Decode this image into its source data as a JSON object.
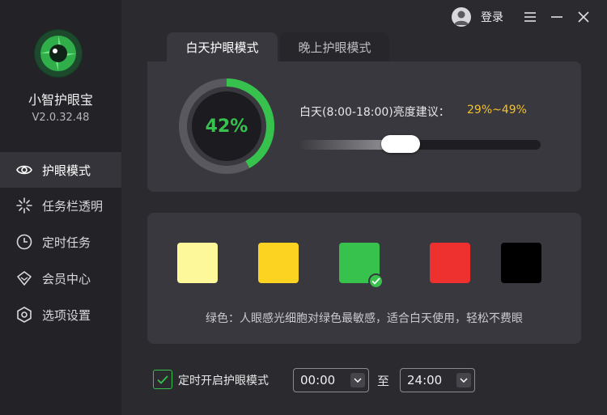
{
  "app": {
    "name": "小智护眼宝",
    "version": "V2.0.32.48"
  },
  "topbar": {
    "login_label": "登录",
    "icons": [
      "user-avatar-icon",
      "menu-icon",
      "minimize-icon",
      "close-icon"
    ]
  },
  "sidebar": {
    "items": [
      {
        "label": "护眼模式",
        "icon": "eye-icon",
        "active": true
      },
      {
        "label": "任务栏透明",
        "icon": "sparkle-icon",
        "active": false
      },
      {
        "label": "定时任务",
        "icon": "clock-icon",
        "active": false
      },
      {
        "label": "会员中心",
        "icon": "diamond-icon",
        "active": false
      },
      {
        "label": "选项设置",
        "icon": "settings-icon",
        "active": false
      }
    ]
  },
  "tabs": [
    {
      "label": "白天护眼模式",
      "active": true
    },
    {
      "label": "晚上护眼模式",
      "active": false
    }
  ],
  "brightness": {
    "value_text": "42%",
    "value": 0.42,
    "advice_label": "白天(8:00-18:00)亮度建议：",
    "advice_range": "29%~49%",
    "slider_level": 0.42
  },
  "colors": {
    "swatches": [
      {
        "name": "light-yellow",
        "hex": "#fdf89a",
        "selected": false
      },
      {
        "name": "yellow",
        "hex": "#fdd322",
        "selected": false
      },
      {
        "name": "green",
        "hex": "#36c24c",
        "selected": true
      },
      {
        "name": "red",
        "hex": "#ee312f",
        "selected": false
      },
      {
        "name": "black",
        "hex": "#000000",
        "selected": false
      }
    ],
    "description": "绿色：人眼感光细胞对绿色最敏感，适合白天使用，轻松不费眼"
  },
  "timer": {
    "checked": true,
    "label": "定时开启护眼模式",
    "start": "00:00",
    "to_label": "至",
    "end": "24:00"
  },
  "theme": {
    "accent": "#36c24c",
    "highlight": "#f2c22e"
  }
}
